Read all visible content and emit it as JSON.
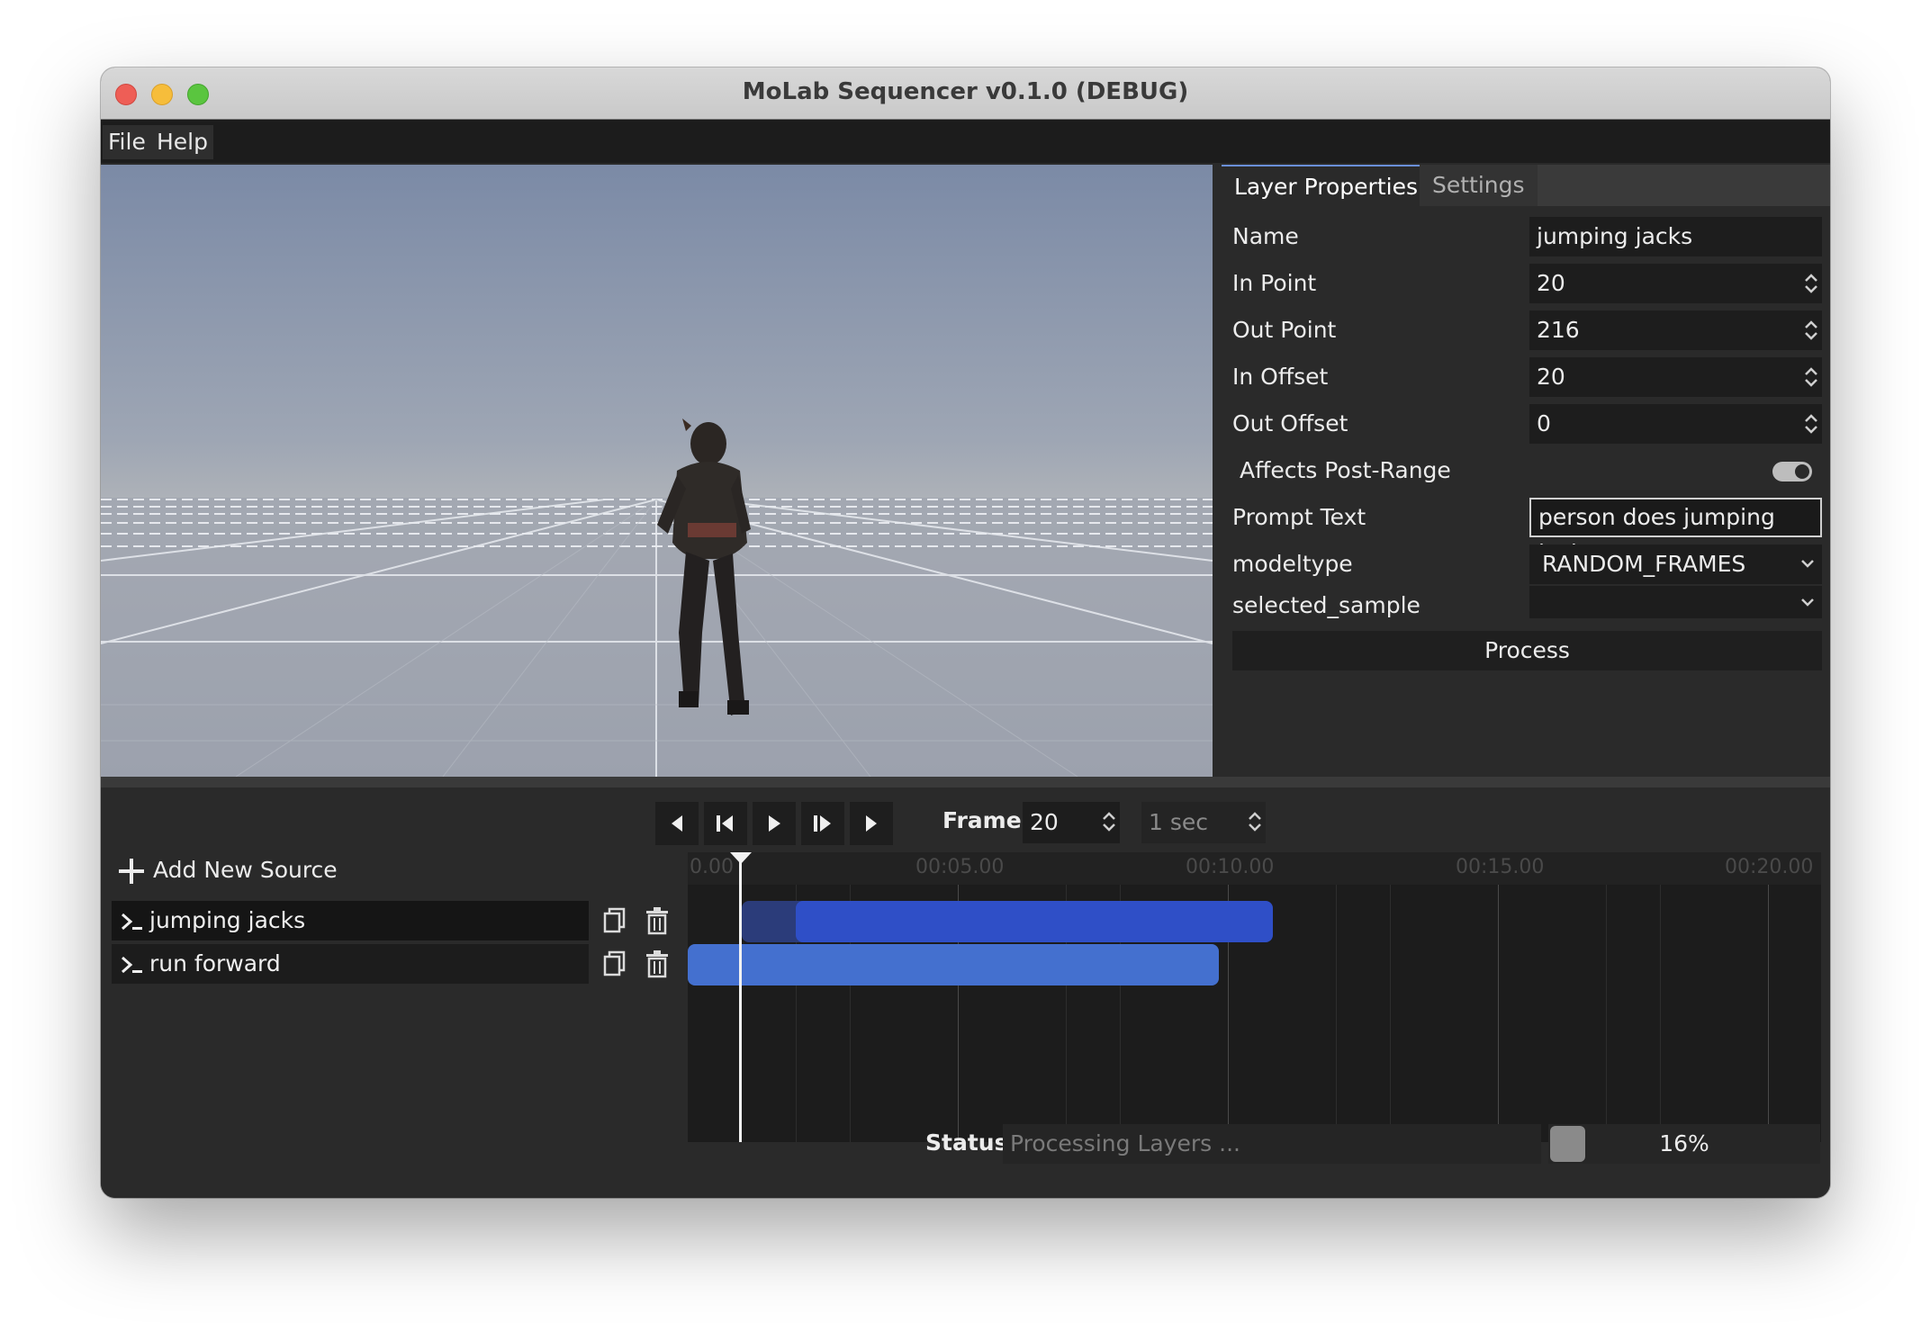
{
  "window": {
    "title": "MoLab Sequencer v0.1.0 (DEBUG)"
  },
  "menu": {
    "file": "File",
    "help": "Help"
  },
  "panel": {
    "tabs": {
      "active": "Layer Properties",
      "inactive": "Settings"
    },
    "properties": {
      "name": {
        "label": "Name",
        "value": "jumping jacks"
      },
      "in_point": {
        "label": "In Point",
        "value": "20"
      },
      "out_point": {
        "label": "Out Point",
        "value": "216"
      },
      "in_offset": {
        "label": "In Offset",
        "value": "20"
      },
      "out_offset": {
        "label": "Out Offset",
        "value": "0"
      },
      "affects_post_range": {
        "label": "Affects Post-Range",
        "enabled": true
      },
      "prompt_text": {
        "label": "Prompt Text",
        "value": "person does jumping jacks"
      },
      "modeltype": {
        "label": "modeltype",
        "value": "RANDOM_FRAMES"
      },
      "selected_sample": {
        "label": "selected_sample",
        "value": ""
      }
    },
    "process_label": "Process"
  },
  "transport": {
    "frame_label": "Frame:",
    "frame_value": "20",
    "step_value": "1 sec",
    "icons": [
      "skip-start-icon",
      "step-back-icon",
      "play-icon",
      "step-forward-icon",
      "skip-end-icon"
    ]
  },
  "sources": {
    "add_label": "Add New Source",
    "layers": [
      {
        "name": "jumping jacks",
        "selected": true
      },
      {
        "name": "run forward",
        "selected": false
      }
    ]
  },
  "timeline": {
    "tick_labels": [
      "0.00",
      "00:05.00",
      "00:10.00",
      "00:15.00",
      "00:20.00"
    ],
    "clip_colors": {
      "jumping_jacks": "#2f4fc7",
      "jumping_jacks_offset": "#2b3c7a",
      "run_forward": "#4470cf"
    }
  },
  "status": {
    "label": "Status:",
    "text": "Processing Layers ...",
    "progress_percent": 16,
    "progress_text": "16%"
  }
}
